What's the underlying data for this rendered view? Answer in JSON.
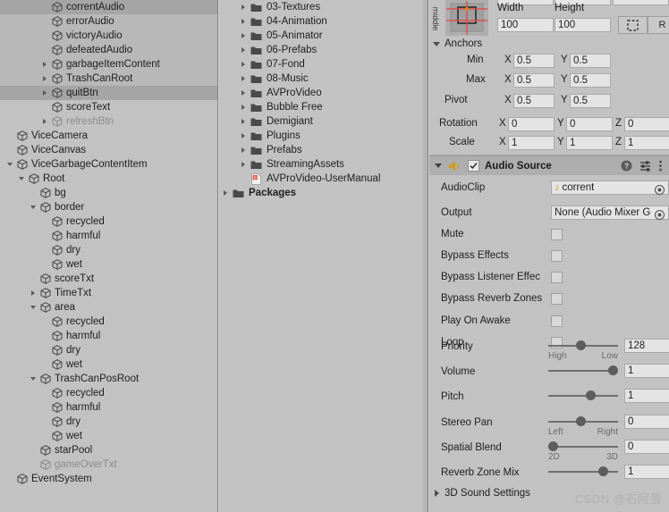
{
  "hierarchy": {
    "panel_name": "Hierarchy",
    "rows": [
      {
        "label": "correntAudio",
        "indent": 3,
        "arrow": "none",
        "selected": "dark",
        "dim": false
      },
      {
        "label": "errorAudio",
        "indent": 3,
        "arrow": "none",
        "selected": "light",
        "dim": false
      },
      {
        "label": "victoryAudio",
        "indent": 3,
        "arrow": "none",
        "selected": "light",
        "dim": false
      },
      {
        "label": "defeatedAudio",
        "indent": 3,
        "arrow": "none",
        "selected": "light",
        "dim": false
      },
      {
        "label": "garbageItemContent",
        "indent": 3,
        "arrow": "closed",
        "selected": "light",
        "dim": false
      },
      {
        "label": "TrashCanRoot",
        "indent": 3,
        "arrow": "closed",
        "selected": "light",
        "dim": false
      },
      {
        "label": "quitBtn",
        "indent": 3,
        "arrow": "closed",
        "selected": "dark",
        "dim": false
      },
      {
        "label": "scoreText",
        "indent": 3,
        "arrow": "none",
        "selected": "none",
        "dim": false
      },
      {
        "label": "refreshBtn",
        "indent": 3,
        "arrow": "closed",
        "selected": "none",
        "dim": true
      },
      {
        "label": "ViceCamera",
        "indent": 0,
        "arrow": "none",
        "selected": "none",
        "dim": false
      },
      {
        "label": "ViceCanvas",
        "indent": 0,
        "arrow": "none",
        "selected": "none",
        "dim": false
      },
      {
        "label": "ViceGarbageContentItem",
        "indent": 0,
        "arrow": "open",
        "selected": "none",
        "dim": false
      },
      {
        "label": "Root",
        "indent": 1,
        "arrow": "open",
        "selected": "none",
        "dim": false
      },
      {
        "label": "bg",
        "indent": 2,
        "arrow": "none",
        "selected": "none",
        "dim": false
      },
      {
        "label": "border",
        "indent": 2,
        "arrow": "open",
        "selected": "none",
        "dim": false
      },
      {
        "label": "recycled",
        "indent": 3,
        "arrow": "none",
        "selected": "none",
        "dim": false
      },
      {
        "label": "harmful",
        "indent": 3,
        "arrow": "none",
        "selected": "none",
        "dim": false
      },
      {
        "label": "dry",
        "indent": 3,
        "arrow": "none",
        "selected": "none",
        "dim": false
      },
      {
        "label": "wet",
        "indent": 3,
        "arrow": "none",
        "selected": "none",
        "dim": false
      },
      {
        "label": "scoreTxt",
        "indent": 2,
        "arrow": "none",
        "selected": "none",
        "dim": false
      },
      {
        "label": "TimeTxt",
        "indent": 2,
        "arrow": "closed",
        "selected": "none",
        "dim": false
      },
      {
        "label": "area",
        "indent": 2,
        "arrow": "open",
        "selected": "none",
        "dim": false
      },
      {
        "label": "recycled",
        "indent": 3,
        "arrow": "none",
        "selected": "none",
        "dim": false
      },
      {
        "label": "harmful",
        "indent": 3,
        "arrow": "none",
        "selected": "none",
        "dim": false
      },
      {
        "label": "dry",
        "indent": 3,
        "arrow": "none",
        "selected": "none",
        "dim": false
      },
      {
        "label": "wet",
        "indent": 3,
        "arrow": "none",
        "selected": "none",
        "dim": false
      },
      {
        "label": "TrashCanPosRoot",
        "indent": 2,
        "arrow": "open",
        "selected": "none",
        "dim": false
      },
      {
        "label": "recycled",
        "indent": 3,
        "arrow": "none",
        "selected": "none",
        "dim": false
      },
      {
        "label": "harmful",
        "indent": 3,
        "arrow": "none",
        "selected": "none",
        "dim": false
      },
      {
        "label": "dry",
        "indent": 3,
        "arrow": "none",
        "selected": "none",
        "dim": false
      },
      {
        "label": "wet",
        "indent": 3,
        "arrow": "none",
        "selected": "none",
        "dim": false
      },
      {
        "label": "starPool",
        "indent": 2,
        "arrow": "none",
        "selected": "none",
        "dim": false
      },
      {
        "label": "gameOverTxt",
        "indent": 2,
        "arrow": "none",
        "selected": "none",
        "dim": true
      },
      {
        "label": "EventSystem",
        "indent": 0,
        "arrow": "none",
        "selected": "none",
        "dim": false
      }
    ]
  },
  "project": {
    "panel_name": "Project",
    "rows": [
      {
        "label": "03-Textures",
        "indent": 1,
        "arrow": "closed",
        "kind": "folder",
        "bold": false
      },
      {
        "label": "04-Animation",
        "indent": 1,
        "arrow": "closed",
        "kind": "folder",
        "bold": false
      },
      {
        "label": "05-Animator",
        "indent": 1,
        "arrow": "closed",
        "kind": "folder",
        "bold": false
      },
      {
        "label": "06-Prefabs",
        "indent": 1,
        "arrow": "closed",
        "kind": "folder",
        "bold": false
      },
      {
        "label": "07-Fond",
        "indent": 1,
        "arrow": "closed",
        "kind": "folder",
        "bold": false
      },
      {
        "label": "08-Music",
        "indent": 1,
        "arrow": "closed",
        "kind": "folder",
        "bold": false
      },
      {
        "label": "AVProVideo",
        "indent": 1,
        "arrow": "closed",
        "kind": "folder",
        "bold": false
      },
      {
        "label": "Bubble Free",
        "indent": 1,
        "arrow": "closed",
        "kind": "folder",
        "bold": false
      },
      {
        "label": "Demigiant",
        "indent": 1,
        "arrow": "closed",
        "kind": "folder",
        "bold": false
      },
      {
        "label": "Plugins",
        "indent": 1,
        "arrow": "closed",
        "kind": "folder",
        "bold": false
      },
      {
        "label": "Prefabs",
        "indent": 1,
        "arrow": "closed",
        "kind": "folder",
        "bold": false
      },
      {
        "label": "StreamingAssets",
        "indent": 1,
        "arrow": "closed",
        "kind": "folder",
        "bold": false
      },
      {
        "label": "AVProVideo-UserManual",
        "indent": 1,
        "arrow": "none",
        "kind": "pdf",
        "bold": false
      },
      {
        "label": "Packages",
        "indent": 0,
        "arrow": "closed",
        "kind": "folder",
        "bold": true
      }
    ]
  },
  "inspector": {
    "panel_name": "Inspector",
    "side_tab_label": "middle",
    "rect_transform": {
      "width_label": "Width",
      "height_label": "Height",
      "width_value": "100",
      "height_value": "100",
      "blueprint_icon": "blueprint-mode-icon",
      "raw_button_label": "R",
      "anchors_label": "Anchors",
      "min_label": "Min",
      "max_label": "Max",
      "pivot_label": "Pivot",
      "rotation_label": "Rotation",
      "scale_label": "Scale",
      "axis_x": "X",
      "axis_y": "Y",
      "axis_z": "Z",
      "min_x": "0.5",
      "min_y": "0.5",
      "max_x": "0.5",
      "max_y": "0.5",
      "pivot_x": "0.5",
      "pivot_y": "0.5",
      "rotation_x": "0",
      "rotation_y": "0",
      "rotation_z": "0",
      "scale_x": "1",
      "scale_y": "1",
      "scale_z": "1"
    },
    "audio_source": {
      "title": "Audio Source",
      "enabled": true,
      "help_icon": "help-icon",
      "preset_icon": "preset-icon",
      "menu_icon": "kebab-menu-icon",
      "component_icon": "audio-source-icon",
      "fields": [
        {
          "label": "AudioClip",
          "type": "object",
          "value": "corrent",
          "has_music_icon": true
        },
        {
          "label": "Output",
          "type": "object",
          "value": "None (Audio Mixer G",
          "has_music_icon": false
        },
        {
          "label": "Mute",
          "type": "toggle",
          "checked": false
        },
        {
          "label": "Bypass Effects",
          "type": "toggle",
          "checked": false
        },
        {
          "label": "Bypass Listener Effec",
          "type": "toggle",
          "checked": false
        },
        {
          "label": "Bypass Reverb Zones",
          "type": "toggle",
          "checked": false
        },
        {
          "label": "Play On Awake",
          "type": "toggle",
          "checked": false
        },
        {
          "label": "Loop",
          "type": "toggle",
          "checked": false
        }
      ],
      "sliders": [
        {
          "label": "Priority",
          "value": "128",
          "pct": 46,
          "left_hint": "High",
          "right_hint": "Low"
        },
        {
          "label": "Volume",
          "value": "1",
          "pct": 100,
          "left_hint": "",
          "right_hint": ""
        },
        {
          "label": "Pitch",
          "value": "1",
          "pct": 63,
          "left_hint": "",
          "right_hint": ""
        },
        {
          "label": "Stereo Pan",
          "value": "0",
          "pct": 47,
          "left_hint": "Left",
          "right_hint": "Right"
        },
        {
          "label": "Spatial Blend",
          "value": "0",
          "pct": 0,
          "left_hint": "2D",
          "right_hint": "3D"
        },
        {
          "label": "Reverb Zone Mix",
          "value": "1",
          "pct": 84,
          "left_hint": "",
          "right_hint": ""
        }
      ],
      "sound_settings_label": "3D Sound Settings"
    }
  },
  "watermark": "CSDN @石阿蛋",
  "colors": {
    "panel_bg": "#c2c2c2",
    "header_bg": "#aeaeae",
    "field_bg": "#e4e4e4",
    "selection_dark": "#a5a5a5",
    "selection_light": "#b8b8b8",
    "text": "#1d1d1d",
    "text_dim": "#8c8c8c",
    "divider": "#7f7f7f",
    "audio_icon": "#d39a22",
    "pdf_icon": "#e05a4e"
  }
}
